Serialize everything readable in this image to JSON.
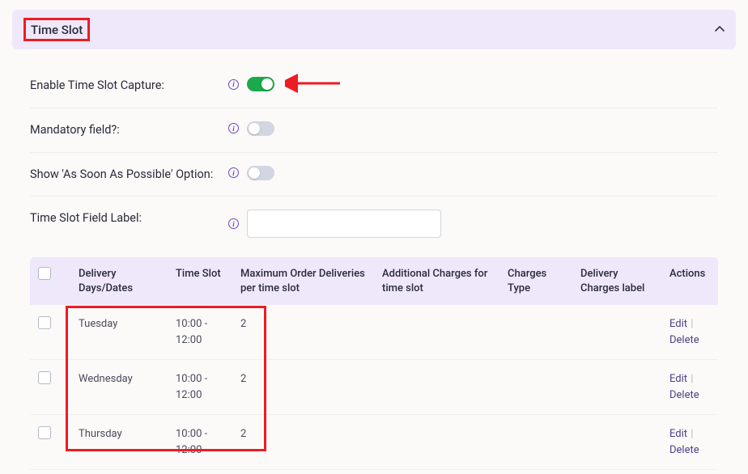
{
  "panel": {
    "title": "Time Slot"
  },
  "fields": {
    "enable_label": "Enable Time Slot Capture:",
    "mandatory_label": "Mandatory field?:",
    "asap_label": "Show 'As Soon As Possible' Option:",
    "field_label_label": "Time Slot Field Label:",
    "field_label_value": ""
  },
  "table": {
    "headers": {
      "days": "Delivery Days/Dates",
      "slot": "Time Slot",
      "max": "Maximum Order Deliveries per time slot",
      "add_charge": "Additional Charges for time slot",
      "ctype": "Charges Type",
      "dclabel": "Delivery Charges label",
      "actions": "Actions"
    },
    "rows": [
      {
        "day": "Tuesday",
        "slot": "10:00 - 12:00",
        "max": "2",
        "add_charge": "",
        "ctype": "",
        "dclabel": ""
      },
      {
        "day": "Wednesday",
        "slot": "10:00 - 12:00",
        "max": "2",
        "add_charge": "",
        "ctype": "",
        "dclabel": ""
      },
      {
        "day": "Thursday",
        "slot": "10:00 - 12:00",
        "max": "2",
        "add_charge": "",
        "ctype": "",
        "dclabel": ""
      }
    ],
    "action_edit": "Edit",
    "action_delete": "Delete"
  }
}
